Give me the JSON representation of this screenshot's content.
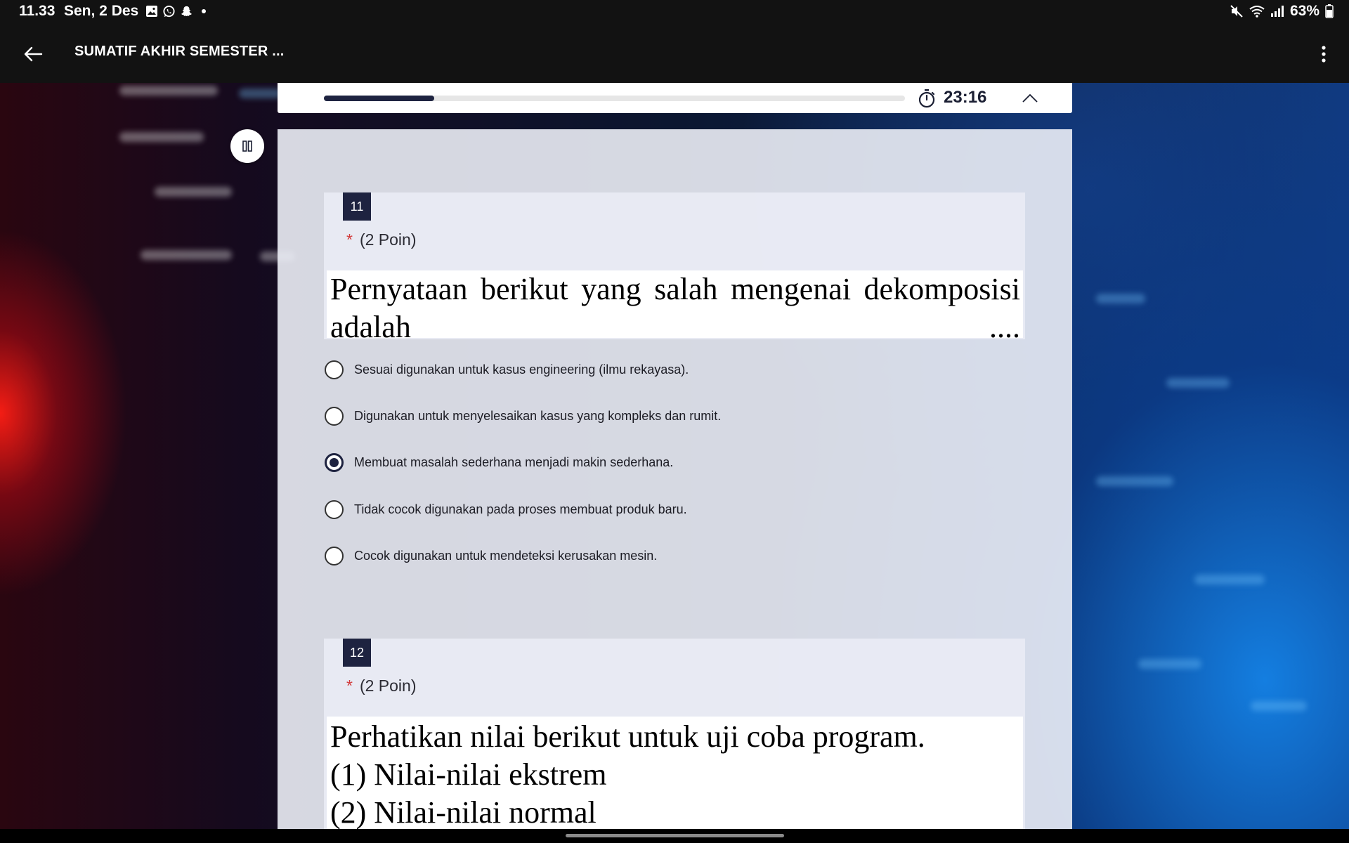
{
  "status_bar": {
    "time": "11.33",
    "date": "Sen, 2 Des",
    "battery": "63%",
    "notification_icons": [
      "gallery-icon",
      "whatsapp-icon",
      "snapchat-icon",
      "dot-icon"
    ],
    "system_icons": [
      "mute-icon",
      "wifi-icon",
      "signal-icon",
      "battery-icon"
    ]
  },
  "app_bar": {
    "title": "SUMATIF AKHIR SEMESTER ..."
  },
  "progress": {
    "fraction": 0.19,
    "timer": "23:16"
  },
  "questions": [
    {
      "number": "11",
      "required_mark": "*",
      "points": "(2 Poin)",
      "text": "Pernyataan berikut yang salah mengenai dekomposisi adalah ....",
      "options": [
        {
          "label": "Sesuai digunakan untuk kasus engineering (ilmu rekayasa).",
          "selected": false
        },
        {
          "label": "Digunakan untuk menyelesaikan kasus yang kompleks dan rumit.",
          "selected": false
        },
        {
          "label": "Membuat masalah sederhana menjadi makin sederhana.",
          "selected": true
        },
        {
          "label": "Tidak cocok digunakan pada proses membuat produk baru.",
          "selected": false
        },
        {
          "label": "Cocok digunakan untuk mendeteksi kerusakan mesin.",
          "selected": false
        }
      ]
    },
    {
      "number": "12",
      "required_mark": "*",
      "points": "(2 Poin)",
      "text_lines": [
        "Perhatikan nilai berikut untuk uji coba program.",
        "(1) Nilai-nilai ekstrem",
        "(2) Nilai-nilai normal"
      ]
    }
  ],
  "colors": {
    "accent": "#1e2340",
    "required": "#d23a3a",
    "bar_background": "#121212"
  }
}
